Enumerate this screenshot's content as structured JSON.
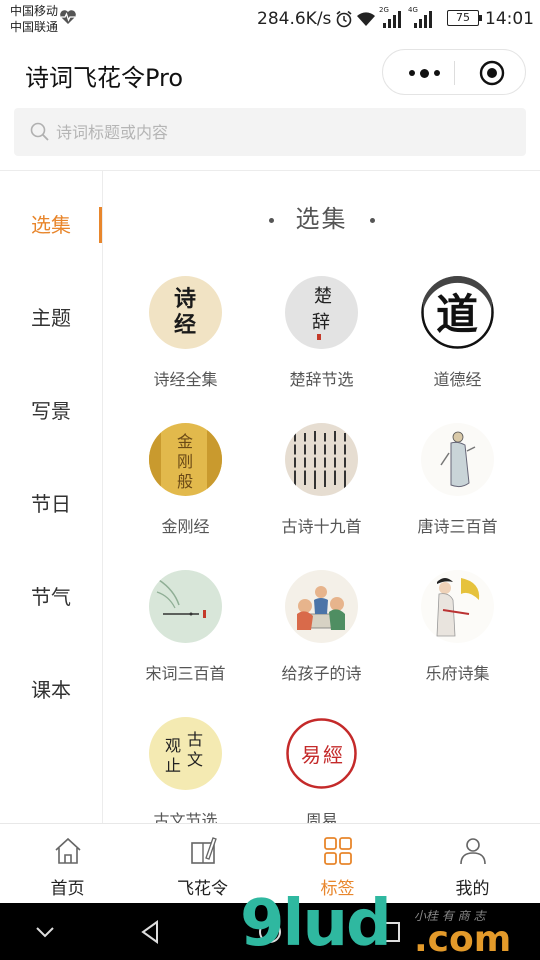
{
  "status_bar": {
    "carrier1": "中国移动",
    "carrier2": "中国联通",
    "speed": "284.6K/s",
    "sig1": "2G",
    "sig2": "4G",
    "battery": "75",
    "time": "14:01"
  },
  "header": {
    "title": "诗词飞花令Pro"
  },
  "search": {
    "placeholder": "诗词标题或内容"
  },
  "sidebar": {
    "items": [
      {
        "label": "选集",
        "active": true
      },
      {
        "label": "主题"
      },
      {
        "label": "写景"
      },
      {
        "label": "节日"
      },
      {
        "label": "节气"
      },
      {
        "label": "课本"
      }
    ]
  },
  "main": {
    "section_title": "选集",
    "items": [
      {
        "label": "诗经全集",
        "icon": "shijing-calligraphy-icon"
      },
      {
        "label": "楚辞节选",
        "icon": "chuci-calligraphy-icon"
      },
      {
        "label": "道德经",
        "icon": "dao-calligraphy-icon"
      },
      {
        "label": "金刚经",
        "icon": "jingang-scroll-icon"
      },
      {
        "label": "古诗十九首",
        "icon": "gushi-manuscript-icon"
      },
      {
        "label": "唐诗三百首",
        "icon": "tang-poet-figure-icon"
      },
      {
        "label": "宋词三百首",
        "icon": "bamboo-painting-icon"
      },
      {
        "label": "给孩子的诗",
        "icon": "children-painting-icon"
      },
      {
        "label": "乐府诗集",
        "icon": "lady-painting-icon"
      },
      {
        "label": "古文节选",
        "icon": "guwen-seal-icon"
      },
      {
        "label": "周易",
        "icon": "yijing-seal-icon"
      }
    ],
    "thumb_text": {
      "shijing": [
        "诗",
        "经"
      ],
      "chuci": [
        "楚",
        "辞"
      ],
      "dao": "道",
      "jingang": [
        "金",
        "刚",
        "般"
      ],
      "guwen": [
        "观",
        "古",
        "止",
        "文"
      ],
      "yijing": [
        "易",
        "經"
      ]
    }
  },
  "tabbar": {
    "tabs": [
      {
        "label": "首页",
        "icon": "home-icon"
      },
      {
        "label": "飞花令",
        "icon": "book-pen-icon"
      },
      {
        "label": "标签",
        "icon": "grid-icon",
        "active": true
      },
      {
        "label": "我的",
        "icon": "person-icon"
      }
    ]
  },
  "watermark": {
    "main": "9lud",
    "suffix": ".com",
    "tag": "小桂 有 商 志"
  },
  "colors": {
    "accent": "#e8862c",
    "text": "#333333",
    "muted": "#555555",
    "search_bg": "#f3f3f3"
  }
}
